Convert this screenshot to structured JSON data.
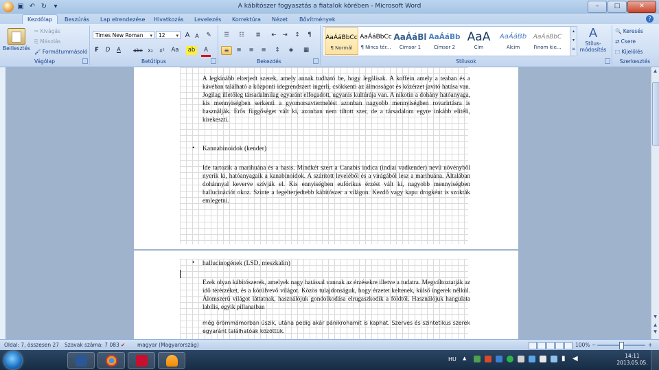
{
  "window": {
    "title": "A kábítószer fogyasztás a fiatalok körében - Microsoft Word",
    "controls": {
      "minimize": "–",
      "maximize": "□",
      "close": "✕"
    }
  },
  "quick_access": [
    {
      "icon": "save-icon",
      "glyph": "▣"
    },
    {
      "icon": "undo-icon",
      "glyph": "↶"
    },
    {
      "icon": "redo-icon",
      "glyph": "↻"
    },
    {
      "icon": "customize-icon",
      "glyph": "▾"
    }
  ],
  "tabs": [
    "Kezdőlap",
    "Beszúrás",
    "Lap elrendezése",
    "Hivatkozás",
    "Levelezés",
    "Korrektúra",
    "Nézet",
    "Bővítmények"
  ],
  "active_tab": "Kezdőlap",
  "ribbon": {
    "clipboard": {
      "label": "Vágólap",
      "paste": "Beillesztés",
      "cut": "Kivágás",
      "copy": "Másolás",
      "format_painter": "Formátummásoló"
    },
    "font": {
      "label": "Betűtípus",
      "family": "Times New Roman",
      "size": "12",
      "grow": "A",
      "shrink": "A",
      "clear": "✎",
      "bold": "F",
      "italic": "D",
      "underline": "A",
      "strike": "abc",
      "subscript": "x₂",
      "superscript": "x²",
      "case": "Aa",
      "highlight": "ab",
      "color": "A"
    },
    "paragraph": {
      "label": "Bekezdés",
      "bullets": "☰",
      "numbering": "☷",
      "multilevel": "≣",
      "decrease_indent": "⇤",
      "increase_indent": "⇥",
      "sort": "↕",
      "show_marks": "¶",
      "align_left": "≡",
      "align_center": "≡",
      "align_right": "≡",
      "justify": "≡",
      "line_spacing": "↕",
      "shading": "◈",
      "borders": "▦"
    },
    "styles": {
      "label": "Stílusok",
      "items": [
        {
          "preview": "AaÁáBbCc",
          "name": "¶ Normál",
          "selected": true
        },
        {
          "preview": "AaÁáBbCc",
          "name": "¶ Nincs tér...",
          "selected": false
        },
        {
          "preview": "AaÁáBl",
          "name": "Címsor 1",
          "selected": false
        },
        {
          "preview": "AaÁáBb",
          "name": "Címsor 2",
          "selected": false
        },
        {
          "preview": "AaA",
          "name": "Cím",
          "selected": false
        },
        {
          "preview": "AaÁáBb",
          "name": "Alcím",
          "selected": false
        },
        {
          "preview": "AaÁáBbC",
          "name": "Finom kie...",
          "selected": false
        }
      ],
      "change_styles": "Stílus-módosítás"
    },
    "editing": {
      "label": "Szerkesztés",
      "find": "Keresés",
      "replace": "Csere",
      "select": "Kijelölés"
    }
  },
  "document": {
    "page1": {
      "para1": "A legkínább elterjedt szerek, amely annak tudható be, hogy legálisak. A koffein amely a teaban és a kávéban található a központi idegrendszert ingerli, csökkenti az álmosságot és közérzet javító hatása van. Jogilag illetőleg társadalmilag egyaránt elfogadott, ugyanis kultúrája van.              A nikotin a dohány hatóanyaga, kis mennyiségben serkenti a gyomorsavtermelést azonban nagyobb mennyiségben rovarirtásra is használják. Erős függőséget vált ki, azonban nem tiltott szer, de a társadalom egyre inkább elítéli, kirekeszti.",
      "bullet": "Kannabinoidok (kender)",
      "para2": "Ide tartozik a marihuána és a hasis. Mindkét szert a Canabis indica (indiai vadkender) nevű növényből nyerik ki, hatóanyagaik a kanabinoidok.  A szárított leveléből és a virágából lesz a marihuána. Általában dohánnyal keverve szívják el. Kis ennyiségben eufórikus érzést vált ki, nagyobb mennyiségben hallucinációt okoz. Szinte a legelterjedtebb kábítószer a világon. Kezdő vagy kapu drogként is szokták emlegetni."
    },
    "page2": {
      "bullet": "hallucinogének (LSD, meszkalin)",
      "para1": "Ezek olyan kábítószerek, amelyek nagy  hatással  vannak az érzésekre illetve a tudatra. Megváltoztatják az idő térérzéket, és a körülvevő világot. Közös tulajdonságuk, hogy érzetet keltenek, külső ingerek nélkül. Álomszerű világot láttatnak, használójuk gondolkodása elrugaszkodik a földtől. Használójuk hangulata labilis, egyik pillanatban",
      "para1_tail": "még örömmámorban úszik, utána pedig akár pánikrohamit is kaphat. Szerves és szintetikus szerek egyaránt találhatóak közöttük."
    }
  },
  "status": {
    "page": "Oldal: 7, összesen 27",
    "words": "Szavak száma: 7 083",
    "language": "magyar (Magyarország)",
    "zoom": "100%"
  },
  "taskbar": {
    "apps": [
      {
        "icon": "word-icon",
        "color": "#2b5797"
      },
      {
        "icon": "chrome-icon",
        "color": "#e0a020"
      },
      {
        "icon": "acrobat-icon",
        "color": "#c8102e"
      },
      {
        "icon": "vlc-icon",
        "color": "#f08a00"
      }
    ],
    "language": "HU",
    "time": "14:11",
    "date": "2013.05.05."
  }
}
